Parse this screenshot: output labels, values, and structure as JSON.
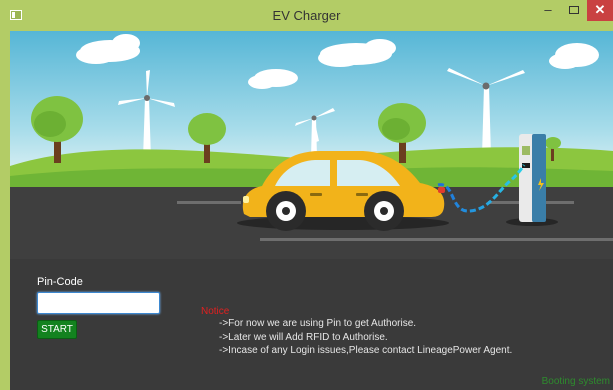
{
  "window": {
    "title": "EV Charger",
    "minimize_label": "–",
    "close_label": "✕"
  },
  "form": {
    "pin_label": "Pin-Code",
    "pin_value": "",
    "start_label": "START"
  },
  "notice": {
    "title": "Notice",
    "lines": [
      "->For now we are using Pin to get Authorise.",
      "->Later we will Add RFID to Authorise.",
      "->Incase of any Login issues,Please contact LineagePower Agent."
    ]
  },
  "status": {
    "text": "Booting system"
  },
  "colors": {
    "titlebar": "#b3cc66",
    "close": "#c94141",
    "panel": "#3a3a3a",
    "start_button": "#13821f",
    "notice_title": "#e02020",
    "car": "#f2b31a"
  }
}
